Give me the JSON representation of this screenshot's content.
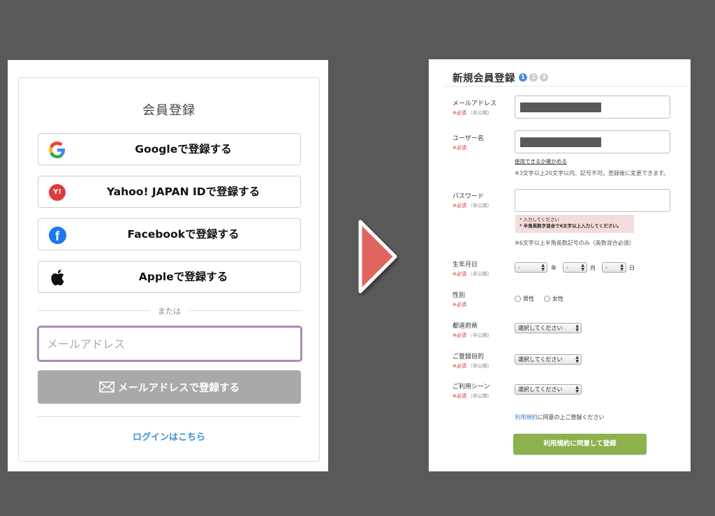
{
  "left": {
    "title": "会員登録",
    "google_label": "Googleで登録する",
    "yahoo_label": "Yahoo! JAPAN IDで登録する",
    "yahoo_icon_text": "Y!",
    "facebook_label": "Facebookで登録する",
    "facebook_icon_text": "f",
    "apple_label": "Appleで登録する",
    "or_text": "または",
    "email_placeholder": "メールアドレス",
    "email_button_label": "メールアドレスで登録する",
    "login_link": "ログインはこちら"
  },
  "right": {
    "title": "新規会員登録",
    "steps": [
      "1",
      "2",
      "3"
    ],
    "required": "※必須",
    "private": "（非公開）",
    "fields": {
      "email_label": "メールアドレス",
      "username_label": "ユーザー名",
      "check_link": "使用できるか確かめる",
      "username_note": "※3文字以上20文字以内、記号不可。登録後に変更できます。",
      "password_label": "パスワード",
      "password_errors": [
        "* 入力してください",
        "* 半角英数字混合で6文字以上入力してください。"
      ],
      "password_note": "※6文字以上半角英数記号のみ（英数混合必須）",
      "birthday_label": "生年月日",
      "birthday_year": "-",
      "birthday_month": "-",
      "birthday_day": "-",
      "year_unit": "年",
      "month_unit": "月",
      "day_unit": "日",
      "gender_label": "性別",
      "male": "男性",
      "female": "女性",
      "prefecture_label": "都道府県",
      "purpose_label": "ご登録目的",
      "scene_label": "ご利用シーン",
      "select_placeholder": "選択してください"
    },
    "terms_link": "利用規約",
    "terms_rest": "に同意の上ご登録ください",
    "submit_label": "利用規約に同意して登録"
  },
  "colors": {
    "background": "#595959",
    "arrow": "#e0655e",
    "step_active": "#4a90d9",
    "step_inactive": "#cccccc",
    "submit": "#8db14d",
    "required": "#d32d2d",
    "input_focus": "#a98bb6"
  },
  "icons": {
    "google": "google-icon",
    "yahoo": "yahoo-icon",
    "facebook": "facebook-icon",
    "apple": "apple-icon",
    "mail": "mail-icon",
    "arrow": "right-arrow-icon"
  }
}
